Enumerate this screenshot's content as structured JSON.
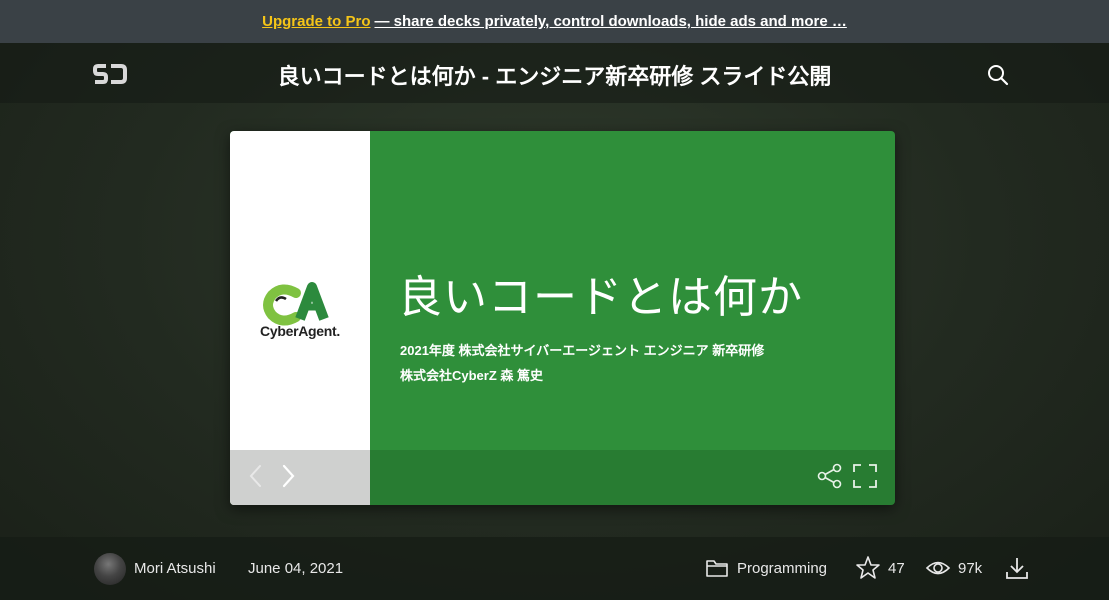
{
  "promo": {
    "link_text": "Upgrade to Pro",
    "text": "— share decks privately, control downloads, hide ads and more …"
  },
  "header": {
    "title": "良いコードとは何か - エンジニア新卒研修 スライド公開"
  },
  "slide": {
    "company_logo_text": "CyberAgent.",
    "heading": "良いコードとは何か",
    "subtitle_line1": "2021年度 株式会社サイバーエージェント エンジニア 新卒研修",
    "subtitle_line2": "株式会社CyberZ 森 篤史",
    "brand_green": "#2f8f3a"
  },
  "footer": {
    "author": "Mori Atsushi",
    "date": "June 04, 2021",
    "category": "Programming",
    "stars": "47",
    "views": "97k"
  },
  "icons": [
    "speakerdeck-logo-icon",
    "search-icon",
    "cyberagent-logo-icon",
    "chevron-left-icon",
    "chevron-right-icon",
    "share-icon",
    "fullscreen-icon",
    "folder-icon",
    "star-icon",
    "eye-icon",
    "download-icon"
  ],
  "colors": {
    "promo_bg": "#3a4146",
    "upgrade_link": "#f5c518",
    "slide_green": "#2f8f3a"
  }
}
